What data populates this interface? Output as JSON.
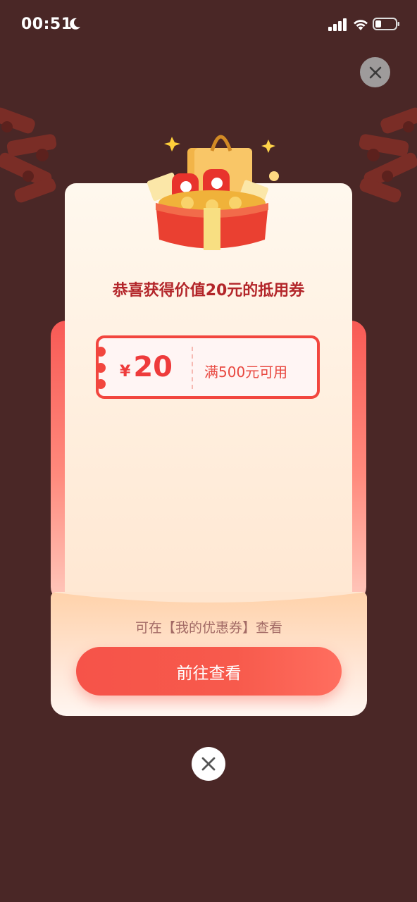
{
  "status_bar": {
    "time": "00:51",
    "moon_icon": "moon-icon",
    "signal_icon": "signal-icon",
    "wifi_icon": "wifi-icon",
    "battery_icon": "battery-icon"
  },
  "dialog": {
    "title": "恭喜获得价值20元的抵用券",
    "coupon": {
      "currency": "¥",
      "amount": "20",
      "condition": "满500元可用"
    },
    "hint": "可在【我的优惠券】查看",
    "button_label": "前往查看"
  },
  "icons": {
    "top_close": "close-icon",
    "bottom_close": "close-icon",
    "gift": "gift-box-icon"
  },
  "colors": {
    "overlay": "#4a2726",
    "accent_red": "#f2463e",
    "title_red": "#b3262a",
    "button_red": "#f65349"
  }
}
